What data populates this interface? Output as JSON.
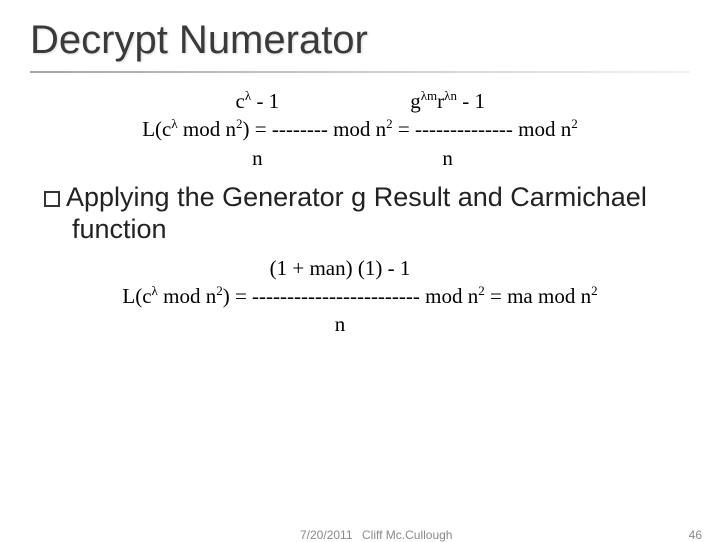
{
  "title": "Decrypt Numerator",
  "eq1": {
    "top_left": "c",
    "top_left_exp": "λ",
    "top_left_tail": " - 1",
    "top_right_a": "g",
    "top_right_a_exp": "λm",
    "top_right_b": "r",
    "top_right_b_exp": "λn",
    "top_right_tail": " - 1",
    "mid_left_1": "L(c",
    "mid_left_exp": "λ",
    "mid_left_2": " mod n",
    "mid_left_2_exp": "2",
    "mid_left_3": ") = -------- mod n",
    "mid_left_3_exp": "2",
    "mid_left_4": " =  -------------- mod n",
    "mid_left_4_exp": "2",
    "bottom_n1": "n",
    "bottom_n2": "n"
  },
  "bullet": {
    "text1": "Applying the Generator g Result and ",
    "text2": "Carmichael function"
  },
  "eq2": {
    "top": "(1 + man) (1) - 1",
    "mid_1": "L(c",
    "mid_1_exp": "λ",
    "mid_2": " mod n",
    "mid_2_exp": "2",
    "mid_3": ") = ------------------------ mod n",
    "mid_3_exp": "2",
    "mid_4": " =  ma mod n",
    "mid_4_exp": "2",
    "bottom_n": "n"
  },
  "footer": {
    "date": "7/20/2011",
    "author": "Cliff Mc.Cullough",
    "page": "46"
  }
}
